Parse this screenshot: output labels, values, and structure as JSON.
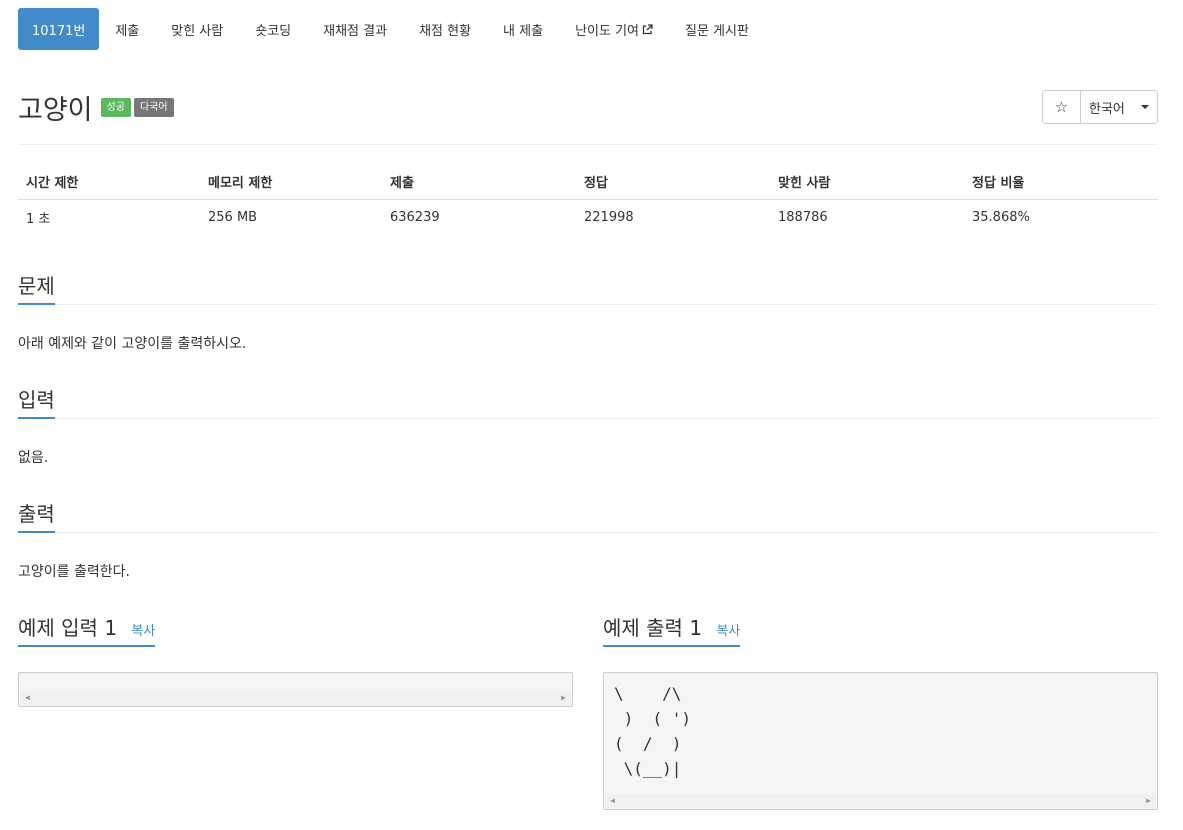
{
  "tabs": [
    {
      "label": "10171번",
      "active": true
    },
    {
      "label": "제출"
    },
    {
      "label": "맞힌 사람"
    },
    {
      "label": "숏코딩"
    },
    {
      "label": "재채점 결과"
    },
    {
      "label": "채점 현황"
    },
    {
      "label": "내 제출"
    },
    {
      "label": "난이도 기여",
      "icon": "external-link-icon"
    },
    {
      "label": "질문 게시판"
    }
  ],
  "problem": {
    "title": "고양이",
    "badge_success": "성공",
    "badge_multilang": "다국어"
  },
  "language_select": {
    "star": "☆",
    "value": "한국어"
  },
  "info_table": {
    "headers": [
      "시간 제한",
      "메모리 제한",
      "제출",
      "정답",
      "맞힌 사람",
      "정답 비율"
    ],
    "values": [
      "1 초",
      "256 MB",
      "636239",
      "221998",
      "188786",
      "35.868%"
    ]
  },
  "sections": {
    "problem_title": "문제",
    "problem_text": "아래 예제와 같이 고양이를 출력하시오.",
    "input_title": "입력",
    "input_text": "없음.",
    "output_title": "출력",
    "output_text": "고양이를 출력한다."
  },
  "examples": {
    "input_title": "예제 입력 1",
    "output_title": "예제 출력 1",
    "copy_label": "복사",
    "input_value": "",
    "output_value": "\\    /\\\n )  ( ')\n(  /  )\n \\(__)|"
  },
  "colors": {
    "accent": "#428bca",
    "success": "#5cb85c",
    "gray": "#777777"
  }
}
